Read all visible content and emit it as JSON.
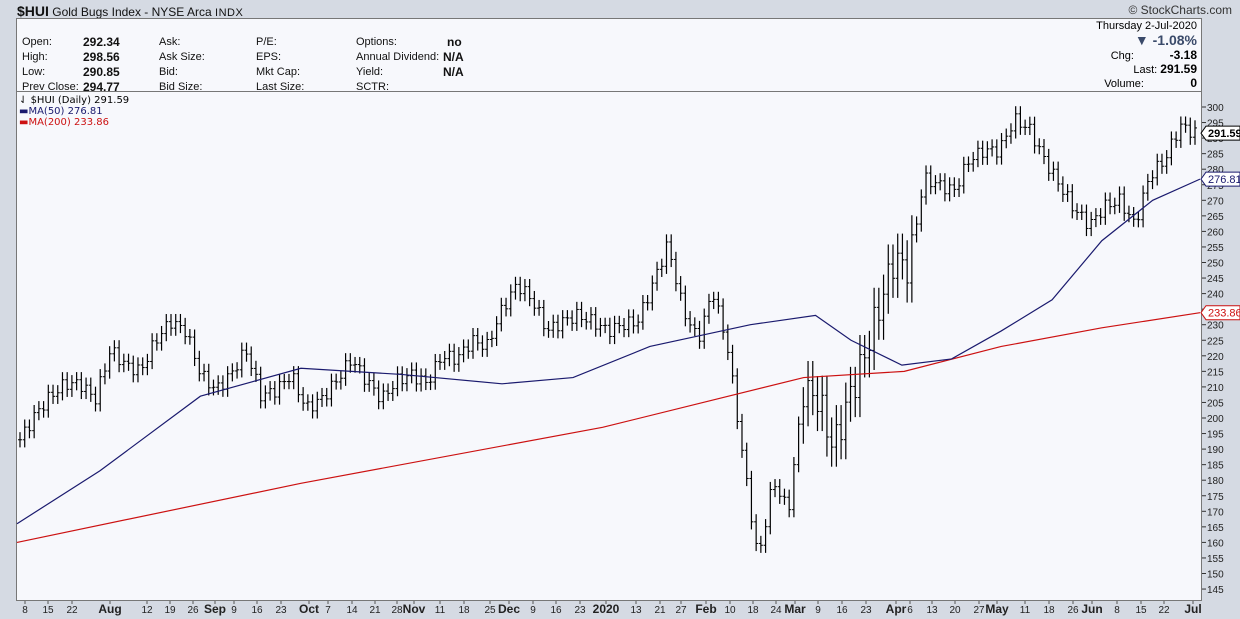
{
  "header": {
    "symbol": "$HUI",
    "name": "Gold Bugs Index - NYSE Arca",
    "exchange": "INDX",
    "copyright": "© StockCharts.com"
  },
  "quote": {
    "open_label": "Open:",
    "open": "292.34",
    "high_label": "High:",
    "high": "298.56",
    "low_label": "Low:",
    "low": "290.85",
    "prev_label": "Prev Close:",
    "prev": "294.77",
    "ask_label": "Ask:",
    "asksize_label": "Ask Size:",
    "bid_label": "Bid:",
    "bidsize_label": "Bid Size:",
    "pe_label": "P/E:",
    "eps_label": "EPS:",
    "mktcap_label": "Mkt Cap:",
    "lastsize_label": "Last Size:",
    "options_label": "Options:",
    "options": "no",
    "div_label": "Annual Dividend:",
    "div": "N/A",
    "yield_label": "Yield:",
    "yield": "N/A",
    "sctr_label": "SCTR:",
    "date": "Thursday  2-Jul-2020",
    "pct": "▼ -1.08%",
    "chg_label": "Chg:",
    "chg": "-3.18",
    "last_label": "Last:",
    "last": "291.59",
    "vol_label": "Volume:",
    "vol": "0"
  },
  "legend": {
    "price": "$HUI (Daily) 291.59",
    "ma50": "MA(50) 276.81",
    "ma200": "MA(200) 233.86"
  },
  "colors": {
    "price": "#000000",
    "ma50": "#1a1a6e",
    "ma200": "#cc1111"
  },
  "chart_data": {
    "type": "ohlc-bar",
    "title": "$HUI Gold Bugs Index (Daily)",
    "ylim": [
      140,
      303
    ],
    "yticks": [
      145,
      150,
      155,
      160,
      165,
      170,
      175,
      180,
      185,
      190,
      195,
      200,
      205,
      210,
      215,
      220,
      225,
      230,
      235,
      240,
      245,
      250,
      255,
      260,
      265,
      270,
      275,
      280,
      285,
      290,
      295,
      300
    ],
    "xticks": [
      "8",
      "15",
      "22",
      "Aug",
      "12",
      "19",
      "26",
      "Sep",
      "9",
      "16",
      "23",
      "Oct",
      "7",
      "14",
      "21",
      "28",
      "Nov",
      "11",
      "18",
      "25",
      "Dec",
      "9",
      "16",
      "23",
      "2020",
      "13",
      "21",
      "27",
      "Feb",
      "10",
      "18",
      "24",
      "Mar",
      "9",
      "16",
      "23",
      "Apr",
      "6",
      "13",
      "20",
      "27",
      "May",
      "11",
      "18",
      "26",
      "Jun",
      "8",
      "15",
      "22",
      "Jul"
    ],
    "close": [
      193,
      201,
      207,
      211,
      211,
      206,
      222,
      217,
      215,
      225,
      231,
      228,
      214,
      209,
      214,
      222,
      207,
      209,
      214,
      203,
      206,
      212,
      219,
      212,
      206,
      212,
      214,
      211,
      220,
      219,
      225,
      223,
      235,
      243,
      238,
      228,
      231,
      233,
      231,
      228,
      230,
      231,
      243,
      256,
      235,
      225,
      241,
      222,
      187,
      154,
      180,
      170,
      209,
      206,
      190,
      206,
      219,
      235,
      251,
      248,
      277,
      275,
      273,
      283,
      286,
      286,
      296,
      293,
      283,
      275,
      267,
      262,
      268,
      270,
      262,
      278,
      283,
      294,
      291.59
    ],
    "ma50": [
      [
        0,
        166
      ],
      [
        0.07,
        183
      ],
      [
        0.155,
        207
      ],
      [
        0.24,
        216
      ],
      [
        0.325,
        214
      ],
      [
        0.41,
        211
      ],
      [
        0.47,
        213
      ],
      [
        0.535,
        223
      ],
      [
        0.62,
        230
      ],
      [
        0.675,
        233
      ],
      [
        0.705,
        225
      ],
      [
        0.748,
        217
      ],
      [
        0.79,
        219
      ],
      [
        0.832,
        228
      ],
      [
        0.875,
        238
      ],
      [
        0.917,
        257
      ],
      [
        0.96,
        270
      ],
      [
        1,
        276.81
      ]
    ],
    "ma200": [
      [
        0,
        160
      ],
      [
        0.24,
        179
      ],
      [
        0.495,
        197
      ],
      [
        0.665,
        213
      ],
      [
        0.75,
        215
      ],
      [
        0.832,
        223
      ],
      [
        0.917,
        229
      ],
      [
        1,
        233.86
      ]
    ],
    "last_label": "291.59",
    "ma50_label": "276.81",
    "ma200_label": "233.86"
  }
}
